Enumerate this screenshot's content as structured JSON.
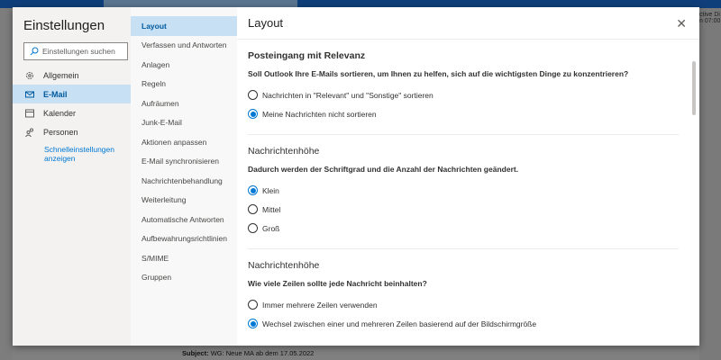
{
  "background": {
    "subject_label": "Subject:",
    "subject_text": "WG: Neue MA ab dem 17.05.2022",
    "right_snippet1": "ctive Di",
    "right_snippet2": "n 07:00"
  },
  "settings": {
    "title": "Einstellungen",
    "search_placeholder": "Einstellungen suchen",
    "categories": [
      {
        "label": "Allgemein"
      },
      {
        "label": "E-Mail"
      },
      {
        "label": "Kalender"
      },
      {
        "label": "Personen"
      }
    ],
    "quick_settings_link": "Schnelleinstellungen anzeigen",
    "nav": [
      "Layout",
      "Verfassen und Antworten",
      "Anlagen",
      "Regeln",
      "Aufräumen",
      "Junk-E-Mail",
      "Aktionen anpassen",
      "E-Mail synchronisieren",
      "Nachrichtenbehandlung",
      "Weiterleitung",
      "Automatische Antworten",
      "Aufbewahrungsrichtlinien",
      "S/MIME",
      "Gruppen"
    ]
  },
  "panel": {
    "title": "Layout",
    "sections": [
      {
        "heading": "Posteingang mit Relevanz",
        "question": "Soll Outlook Ihre E-Mails sortieren, um Ihnen zu helfen, sich auf die wichtigsten Dinge zu konzentrieren?",
        "options": [
          "Nachrichten in \"Relevant\" und \"Sonstige\" sortieren",
          "Meine Nachrichten nicht sortieren"
        ],
        "selected": 1
      },
      {
        "heading": "Nachrichtenhöhe",
        "question": "Dadurch werden der Schriftgrad und die Anzahl der Nachrichten geändert.",
        "options": [
          "Klein",
          "Mittel",
          "Groß"
        ],
        "selected": 0
      },
      {
        "heading": "Nachrichtenhöhe",
        "question": "Wie viele Zeilen sollte jede Nachricht beinhalten?",
        "options": [
          "Immer mehrere Zeilen verwenden",
          "Wechsel zwischen einer und mehreren Zeilen basierend auf der Bildschirmgröße"
        ],
        "selected": 1
      }
    ]
  }
}
